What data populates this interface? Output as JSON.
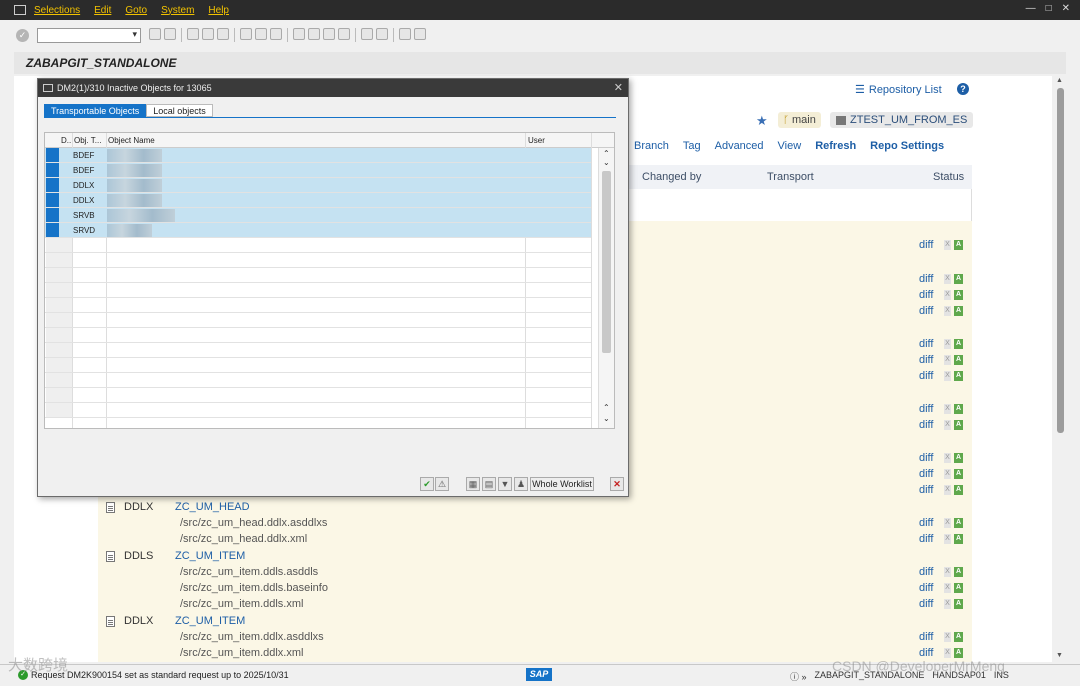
{
  "menu": [
    "Selections",
    "Edit",
    "Goto",
    "System",
    "Help"
  ],
  "page_title": "ZABAPGIT_STANDALONE",
  "header": {
    "repo_list": "Repository List",
    "help": "?"
  },
  "repo": {
    "branch": "main",
    "package": "ZTEST_UM_FROM_ES"
  },
  "repo_menu": [
    "Branch",
    "Tag",
    "Advanced",
    "View",
    "Refresh",
    "Repo Settings"
  ],
  "table_headers": {
    "changed_by": "Changed by",
    "transport": "Transport",
    "status": "Status"
  },
  "diff_label": "diff",
  "status_x": "X",
  "status_a": "A",
  "objects": [
    {
      "type": "DDLX",
      "name": "ZC_UM_HEAD",
      "paths": [
        "/src/zc_um_head.ddlx.asddlxs",
        "/src/zc_um_head.ddlx.xml"
      ]
    },
    {
      "type": "DDLS",
      "name": "ZC_UM_ITEM",
      "paths": [
        "/src/zc_um_item.ddls.asddls",
        "/src/zc_um_item.ddls.baseinfo",
        "/src/zc_um_item.ddls.xml"
      ]
    },
    {
      "type": "DDLX",
      "name": "ZC_UM_ITEM",
      "paths": [
        "/src/zc_um_item.ddlx.asddlxs",
        "/src/zc_um_item.ddlx.xml"
      ]
    }
  ],
  "dialog": {
    "title": "DM2(1)/310 Inactive Objects for 13065",
    "tabs": [
      "Transportable Objects",
      "Local objects"
    ],
    "columns": {
      "d": "D..",
      "obj_type": "Obj. T...",
      "obj_name": "Object Name",
      "user": "User"
    },
    "rows": [
      {
        "type": "BDEF"
      },
      {
        "type": "BDEF"
      },
      {
        "type": "DDLX"
      },
      {
        "type": "DDLX"
      },
      {
        "type": "SRVB"
      },
      {
        "type": "SRVD"
      }
    ],
    "whole_worklist": "Whole Worklist"
  },
  "status": {
    "message": "Request DM2K900154 set as standard request up to 2025/10/31",
    "system": "ZABAPGIT_STANDALONE",
    "client": "HANDSAP01",
    "mode": "INS",
    "sap_logo": "SAP"
  },
  "watermark": {
    "left": "大数跨境",
    "right": "CSDN @DeveloperMrMeng"
  }
}
